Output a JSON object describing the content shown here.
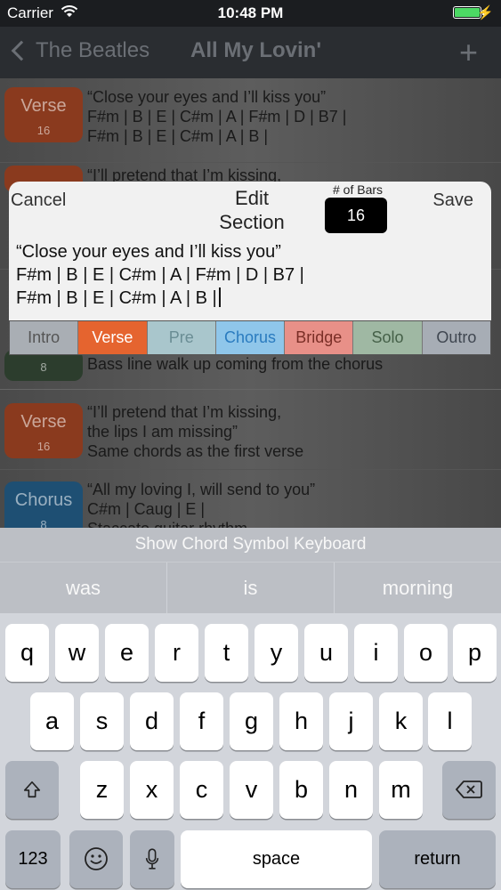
{
  "status_bar": {
    "carrier": "Carrier",
    "time": "10:48 PM"
  },
  "nav": {
    "back_label": "The Beatles",
    "title": "All My Lovin'",
    "add_symbol": "+"
  },
  "sections": [
    {
      "name": "Verse",
      "bars": "16",
      "color": "#8a3a1e",
      "lines": "“Close your eyes and I’ll kiss you”\nF#m | B | E | C#m | A | F#m | D | B7 |\nF#m | B | E | C#m | A | B |"
    },
    {
      "name": "",
      "bars": "",
      "color": "#8a3a1e",
      "lines": "“I’ll pretend that I’m kissing,"
    },
    {
      "name": "",
      "bars": "8",
      "color": "#2c3d2d",
      "lines": "Bass line walk up coming from the chorus"
    },
    {
      "name": "Verse",
      "bars": "16",
      "color": "#8a3a1e",
      "lines": "“I’ll pretend that I’m kissing,\nthe lips I am missing”\nSame chords as the first verse"
    },
    {
      "name": "Chorus",
      "bars": "8",
      "color": "#1e4f73",
      "lines": "“All my loving I, will send to you”\nC#m | Caug | E |\nStaccato guitar rhythm"
    }
  ],
  "edit_modal": {
    "cancel_label": "Cancel",
    "title_line1": "Edit",
    "title_line2": "Section",
    "bars_label": "# of Bars",
    "bars_value": "16",
    "save_label": "Save",
    "text_lines": [
      "“Close your eyes and I’ll kiss you”",
      "F#m | B | E | C#m | A | F#m | D | B7 |",
      "F#m | B | E | C#m | A | B |"
    ]
  },
  "section_types": [
    {
      "label": "Intro",
      "selected": false
    },
    {
      "label": "Verse",
      "selected": true
    },
    {
      "label": "Pre",
      "selected": false
    },
    {
      "label": "Chorus",
      "selected": false
    },
    {
      "label": "Bridge",
      "selected": false
    },
    {
      "label": "Solo",
      "selected": false
    },
    {
      "label": "Outro",
      "selected": false
    }
  ],
  "keyboard": {
    "chord_bar_label": "Show Chord Symbol Keyboard",
    "suggestions": [
      "was",
      "is",
      "morning"
    ],
    "row1": [
      "q",
      "w",
      "e",
      "r",
      "t",
      "y",
      "u",
      "i",
      "o",
      "p"
    ],
    "row2": [
      "a",
      "s",
      "d",
      "f",
      "g",
      "h",
      "j",
      "k",
      "l"
    ],
    "row3": [
      "z",
      "x",
      "c",
      "v",
      "b",
      "n",
      "m"
    ],
    "numbers_label": "123",
    "space_label": "space",
    "return_label": "return"
  },
  "colors": {
    "accent_orange": "#e5642f",
    "battery_green": "#4cd964"
  }
}
